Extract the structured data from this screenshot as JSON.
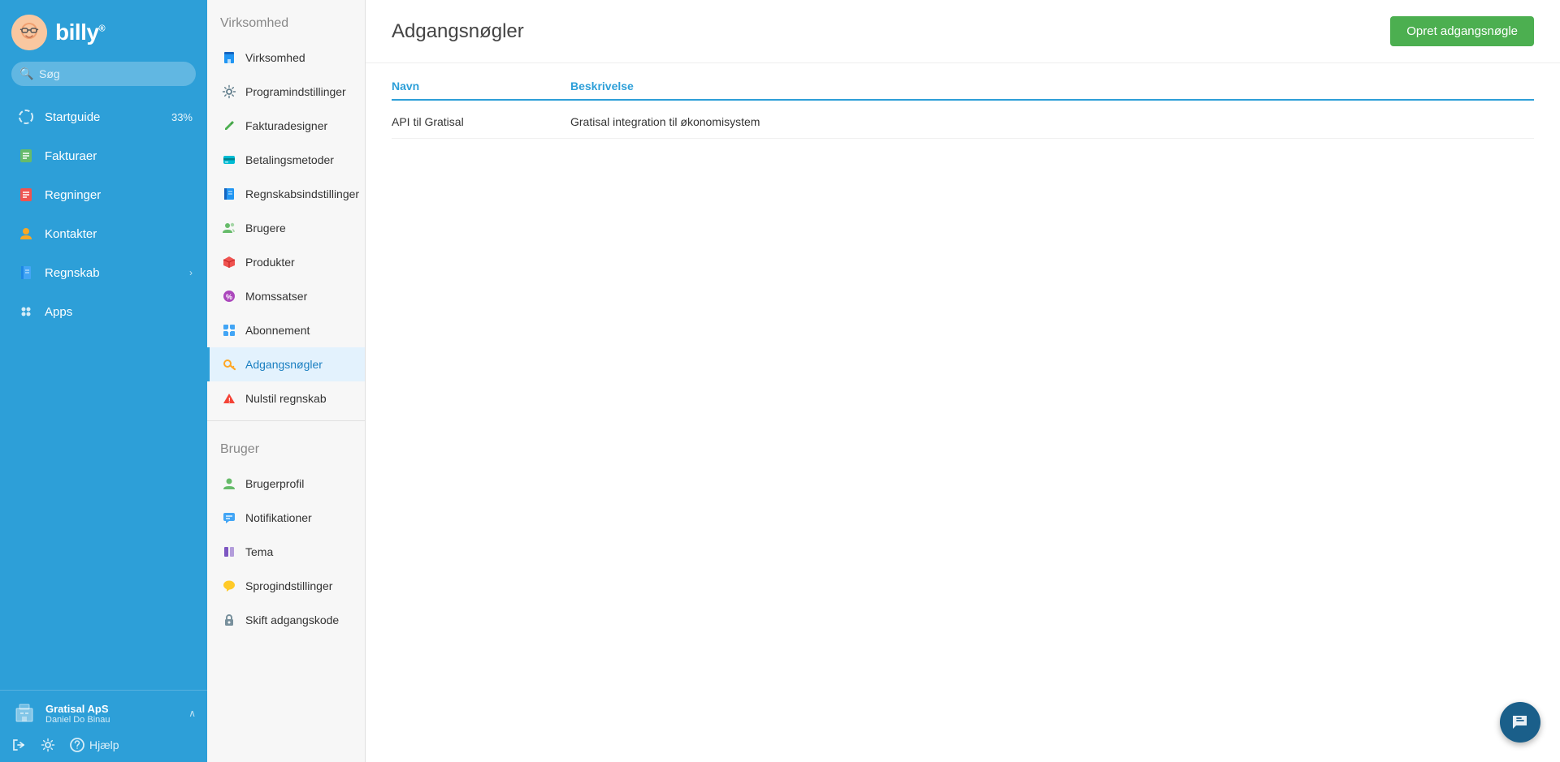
{
  "sidebar": {
    "logo_text": "billy",
    "logo_sup": "®",
    "search_placeholder": "Søg",
    "nav_items": [
      {
        "id": "startguide",
        "label": "Startguide",
        "badge": "33%",
        "icon": "circle-dash"
      },
      {
        "id": "fakturaer",
        "label": "Fakturaer",
        "icon": "invoice"
      },
      {
        "id": "regninger",
        "label": "Regninger",
        "icon": "bill"
      },
      {
        "id": "kontakter",
        "label": "Kontakter",
        "icon": "person"
      },
      {
        "id": "regnskab",
        "label": "Regnskab",
        "icon": "book",
        "arrow": "›"
      },
      {
        "id": "apps",
        "label": "Apps",
        "icon": "apps"
      }
    ],
    "company_name": "Gratisal ApS",
    "company_user": "Daniel Do Binau",
    "bottom_actions": [
      {
        "id": "logout",
        "icon": "logout"
      },
      {
        "id": "settings",
        "icon": "settings"
      },
      {
        "id": "help",
        "icon": "help",
        "label": "Hjælp"
      }
    ]
  },
  "sub_nav": {
    "virksomhed_section": "Virksomhed",
    "virksomhed_items": [
      {
        "id": "virksomhed",
        "label": "Virksomhed",
        "icon": "building",
        "color": "#2196f3"
      },
      {
        "id": "programindstillinger",
        "label": "Programindstillinger",
        "icon": "gear",
        "color": "#607d8b"
      },
      {
        "id": "fakturadesigner",
        "label": "Fakturadesigner",
        "icon": "pencil",
        "color": "#4caf50"
      },
      {
        "id": "betalingsmetoder",
        "label": "Betalingsmetoder",
        "icon": "card",
        "color": "#00bcd4"
      },
      {
        "id": "regnskabsindstillinger",
        "label": "Regnskabsindstillinger",
        "icon": "book2",
        "color": "#2196f3"
      },
      {
        "id": "brugere",
        "label": "Brugere",
        "icon": "users",
        "color": "#66bb6a"
      },
      {
        "id": "produkter",
        "label": "Produkter",
        "icon": "box",
        "color": "#ef5350"
      },
      {
        "id": "momssatser",
        "label": "Momssatser",
        "icon": "percent",
        "color": "#ab47bc"
      },
      {
        "id": "abonnement",
        "label": "Abonnement",
        "icon": "puzzle",
        "color": "#42a5f5"
      },
      {
        "id": "adgangsnogler",
        "label": "Adgangsnøgler",
        "icon": "key",
        "color": "#ffa726",
        "active": true
      },
      {
        "id": "nulstil-regnskab",
        "label": "Nulstil regnskab",
        "icon": "triangle",
        "color": "#f44336"
      }
    ],
    "bruger_section": "Bruger",
    "bruger_items": [
      {
        "id": "brugerprofil",
        "label": "Brugerprofil",
        "icon": "user-profile",
        "color": "#66bb6a"
      },
      {
        "id": "notifikationer",
        "label": "Notifikationer",
        "icon": "chat",
        "color": "#42a5f5"
      },
      {
        "id": "tema",
        "label": "Tema",
        "icon": "palette",
        "color": "#7e57c2"
      },
      {
        "id": "sprogindstillinger",
        "label": "Sprogindstillinger",
        "icon": "speech",
        "color": "#ffca28"
      },
      {
        "id": "skift-adgangskode",
        "label": "Skift adgangskode",
        "icon": "lock",
        "color": "#78909c"
      }
    ]
  },
  "main": {
    "title": "Adgangsnøgler",
    "create_button": "Opret adgangsnøgle",
    "table": {
      "col_navn": "Navn",
      "col_beskrivelse": "Beskrivelse",
      "rows": [
        {
          "navn": "API til Gratisal",
          "beskrivelse": "Gratisal integration til økonomisystem"
        }
      ]
    }
  }
}
